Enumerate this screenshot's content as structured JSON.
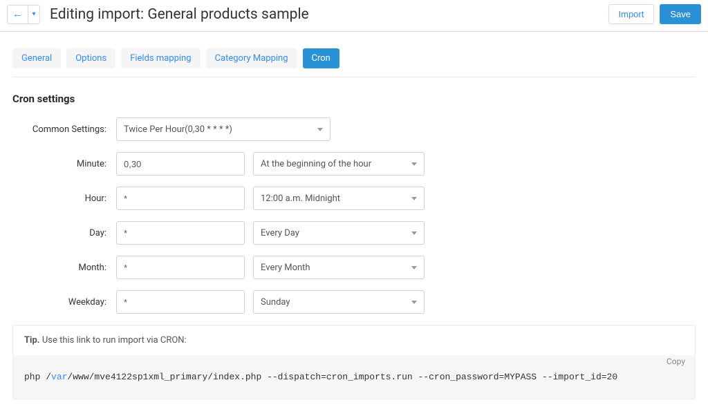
{
  "header": {
    "back_icon": "←",
    "caret_icon": "▾",
    "title": "Editing import: General products sample",
    "import_label": "Import",
    "save_label": "Save"
  },
  "tabs": [
    {
      "label": "General",
      "active": false
    },
    {
      "label": "Options",
      "active": false
    },
    {
      "label": "Fields mapping",
      "active": false
    },
    {
      "label": "Category Mapping",
      "active": false
    },
    {
      "label": "Cron",
      "active": true
    }
  ],
  "section_heading": "Cron settings",
  "form": {
    "common_settings_label": "Common Settings:",
    "common_settings_value": "Twice Per Hour(0,30 * * * *)",
    "minute_label": "Minute:",
    "minute_value": "0,30",
    "minute_select": "At the beginning of the hour",
    "hour_label": "Hour:",
    "hour_value": "*",
    "hour_select": "12:00 a.m. Midnight",
    "day_label": "Day:",
    "day_value": "*",
    "day_select": "Every Day",
    "month_label": "Month:",
    "month_value": "*",
    "month_select": "Every Month",
    "weekday_label": "Weekday:",
    "weekday_value": "*",
    "weekday_select": "Sunday"
  },
  "tip": {
    "bold": "Tip.",
    "text": " Use this link to run import via CRON:",
    "copy": "Copy"
  },
  "cron_command": {
    "pre": "php /",
    "var": "var",
    "post": "/www/mve4122sp1xml_primary/index.php --dispatch=cron_imports.run --cron_password=MYPASS --import_id=20"
  }
}
